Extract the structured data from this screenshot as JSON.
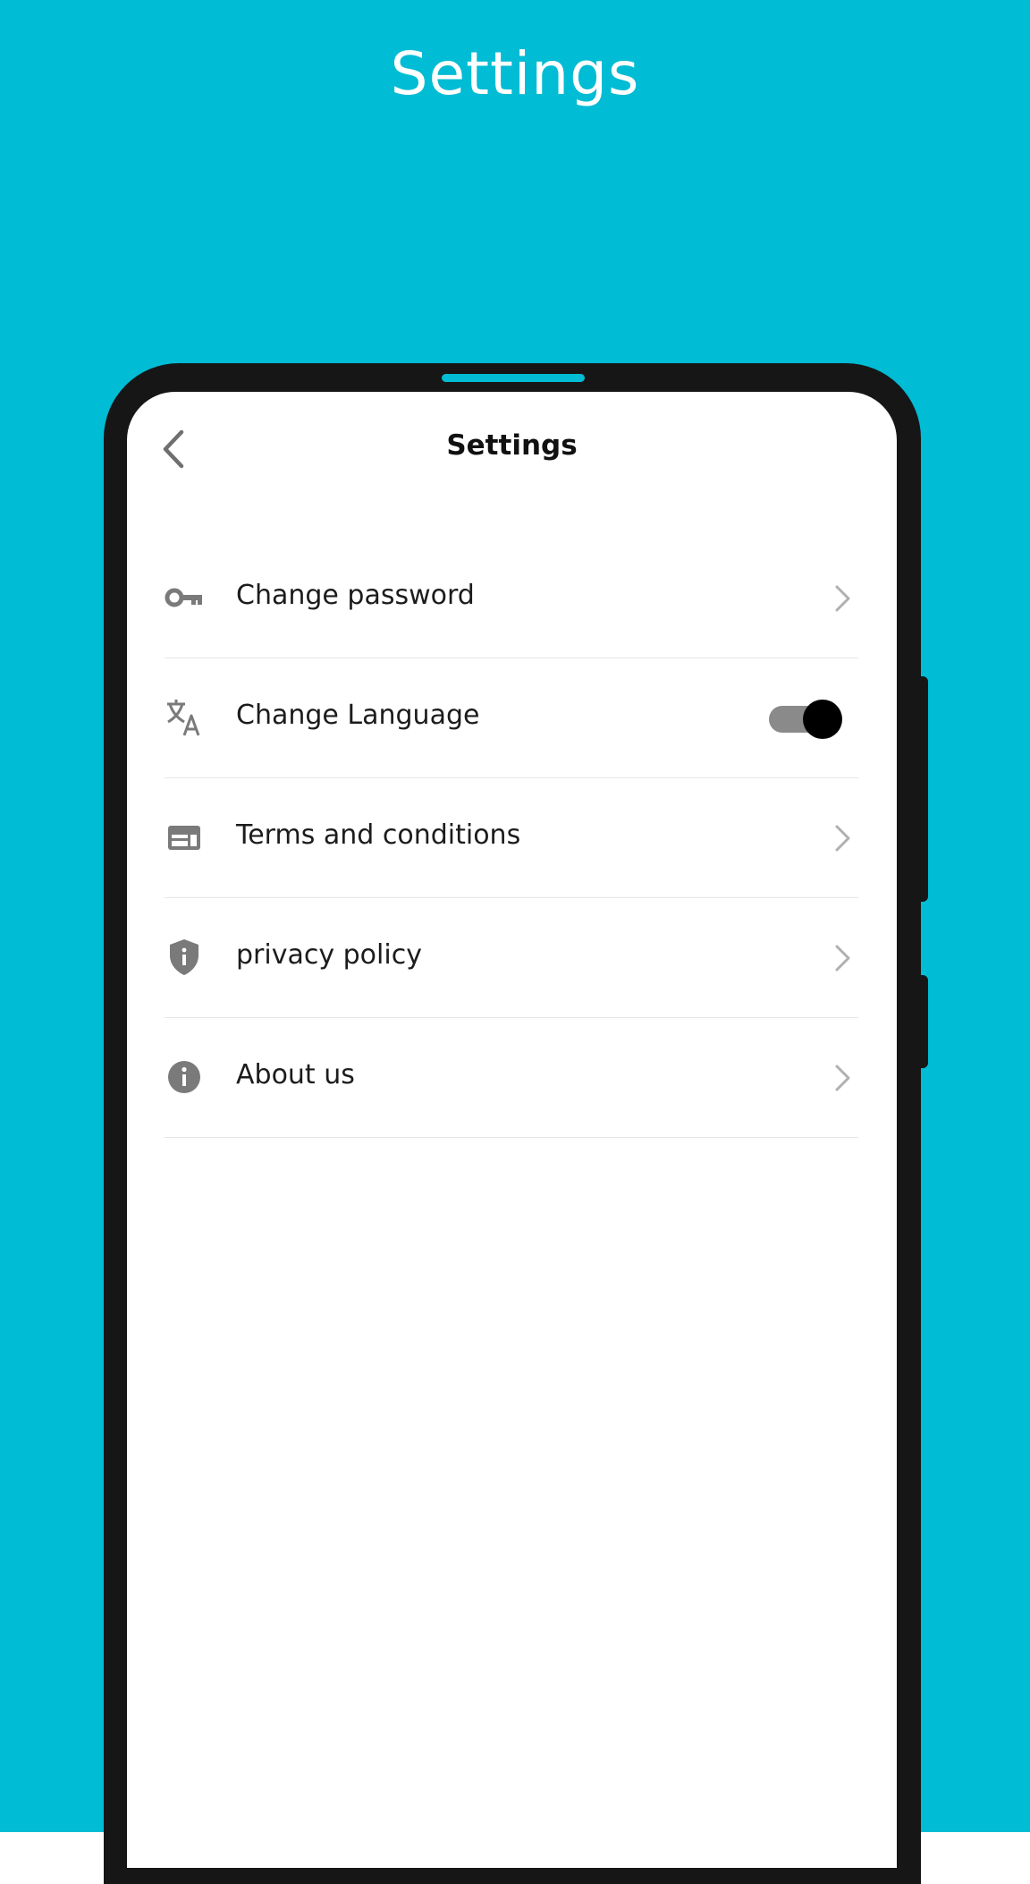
{
  "promo": {
    "title": "Settings",
    "background_color": "#00BCD4"
  },
  "header": {
    "title": "Settings",
    "back_icon": "chevron-left-icon"
  },
  "settings": {
    "items": [
      {
        "label": "Change password",
        "icon": "key-icon",
        "trailing": "chevron-right-icon"
      },
      {
        "label": "Change Language",
        "icon": "translate-icon",
        "trailing": "toggle",
        "toggle_on": true
      },
      {
        "label": "Terms and conditions",
        "icon": "web-layout-icon",
        "trailing": "chevron-right-icon"
      },
      {
        "label": "privacy policy",
        "icon": "shield-info-icon",
        "trailing": "chevron-right-icon"
      },
      {
        "label": "About us",
        "icon": "info-icon",
        "trailing": "chevron-right-icon"
      }
    ]
  },
  "colors": {
    "icon": "#7a7a7a",
    "chevron": "#b0b0b0",
    "toggle_track": "#8a8a8a",
    "toggle_thumb": "#000000"
  }
}
